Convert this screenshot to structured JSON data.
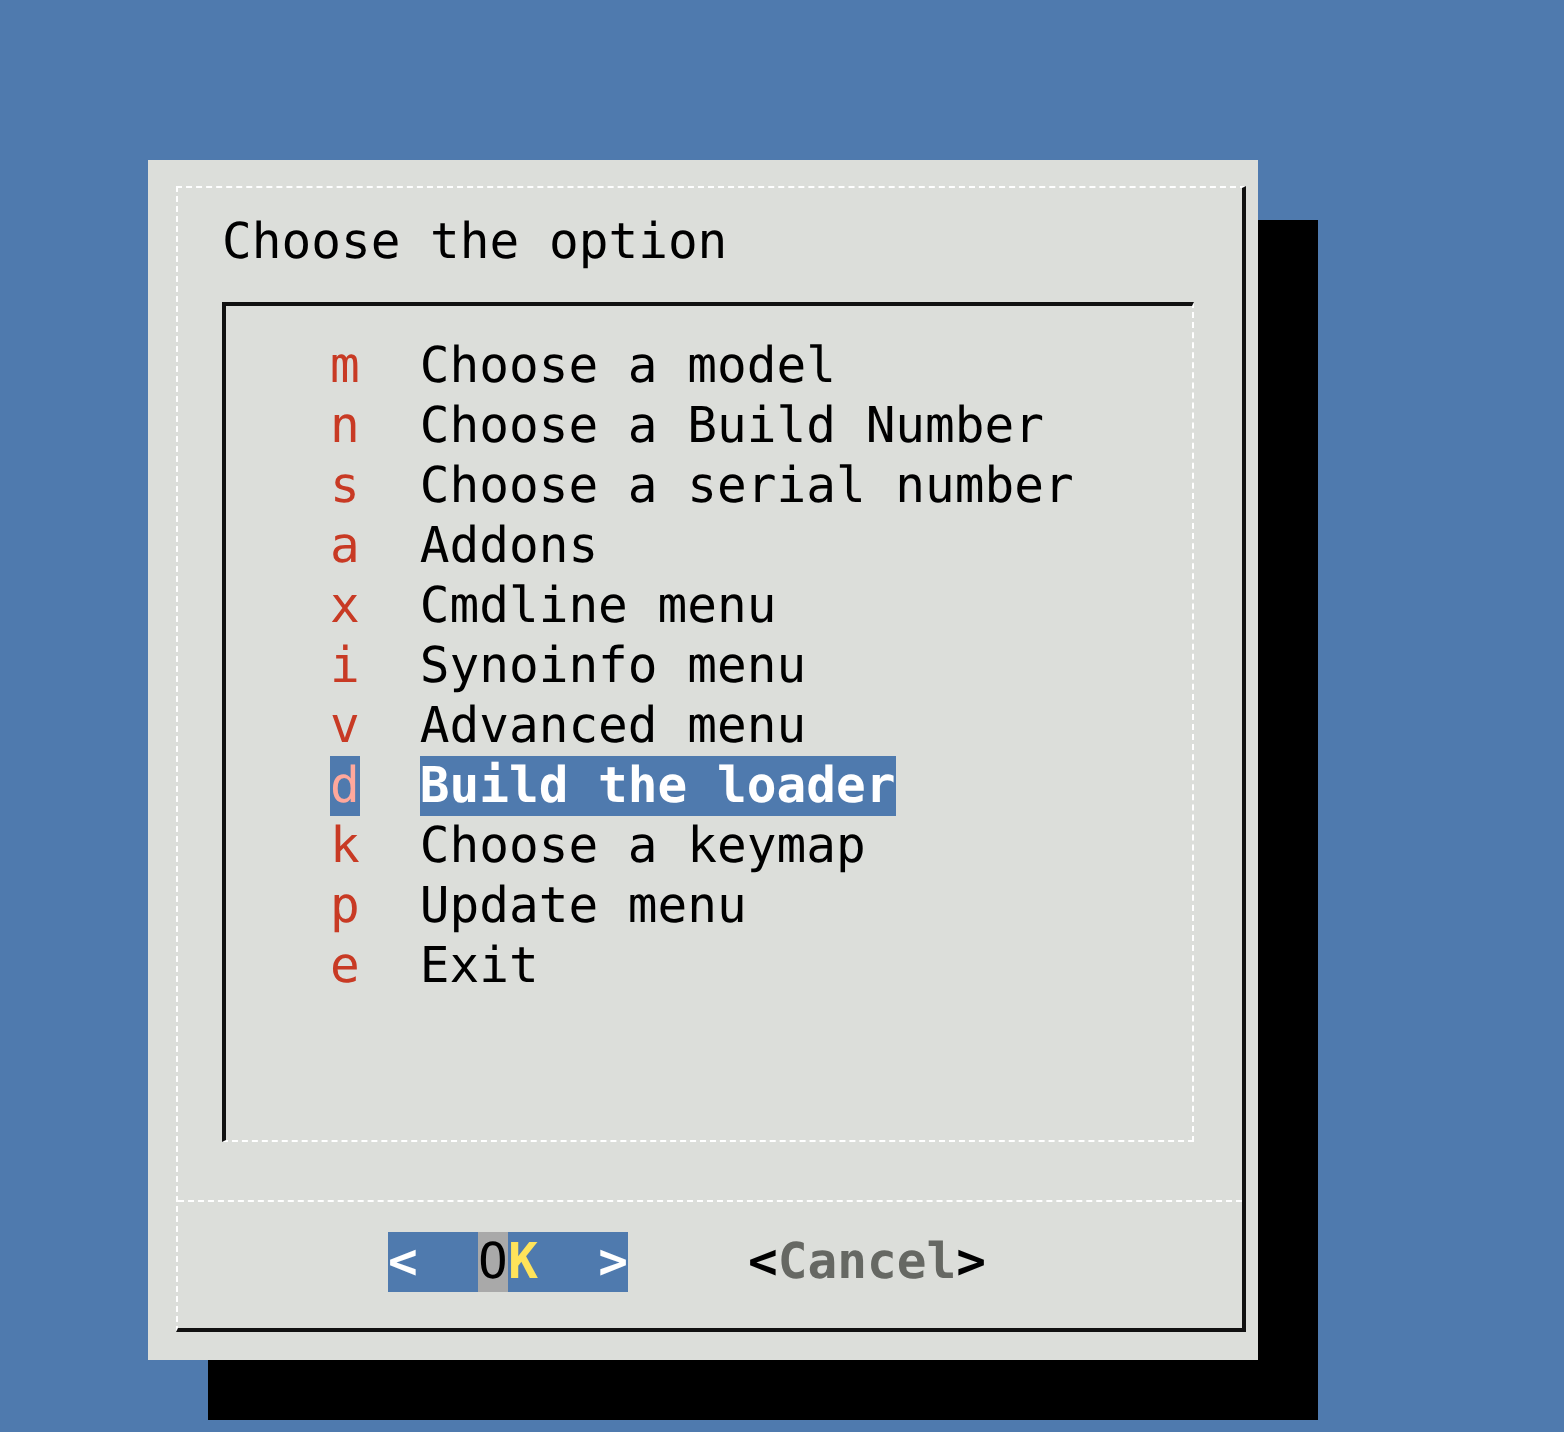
{
  "dialog": {
    "title": "Choose the option",
    "menu": [
      {
        "tag": "m",
        "label": "Choose a model",
        "selected": false
      },
      {
        "tag": "n",
        "label": "Choose a Build Number",
        "selected": false
      },
      {
        "tag": "s",
        "label": "Choose a serial number",
        "selected": false
      },
      {
        "tag": "a",
        "label": "Addons",
        "selected": false
      },
      {
        "tag": "x",
        "label": "Cmdline menu",
        "selected": false
      },
      {
        "tag": "i",
        "label": "Synoinfo menu",
        "selected": false
      },
      {
        "tag": "v",
        "label": "Advanced menu",
        "selected": false
      },
      {
        "tag": "d",
        "label": "Build the loader",
        "selected": true
      },
      {
        "tag": "k",
        "label": "Choose a keymap",
        "selected": false
      },
      {
        "tag": "p",
        "label": "Update menu",
        "selected": false
      },
      {
        "tag": "e",
        "label": "Exit",
        "selected": false
      }
    ],
    "buttons": [
      {
        "open": "<",
        "label": "OK",
        "close": ">",
        "selected": true
      },
      {
        "open": "<",
        "label": "Cancel",
        "close": ">",
        "selected": false
      }
    ]
  }
}
